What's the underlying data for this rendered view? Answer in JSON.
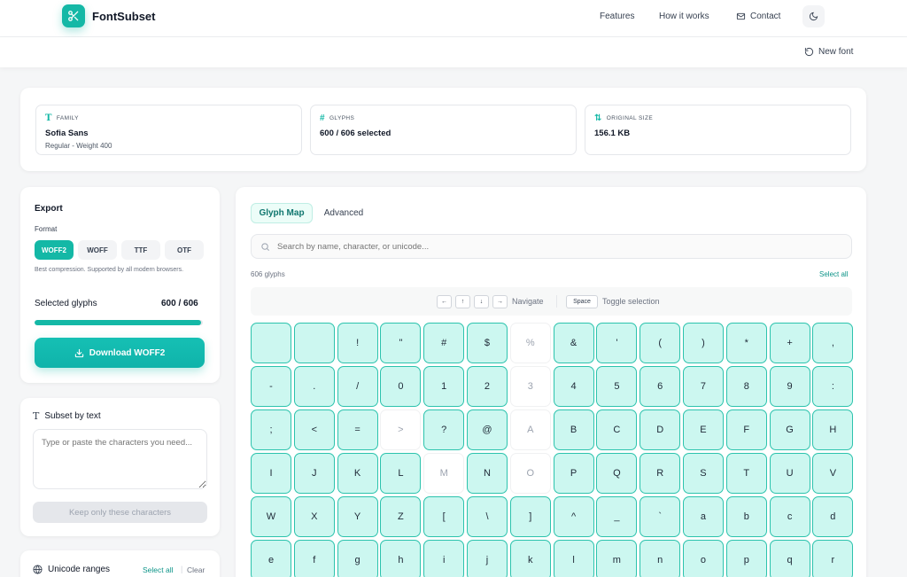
{
  "app": {
    "name": "FontSubset"
  },
  "nav": {
    "features": "Features",
    "how": "How it works",
    "contact": "Contact"
  },
  "subbar": {
    "new_font": "New font"
  },
  "stats": {
    "family_label": "FAMILY",
    "family": "Sofia Sans",
    "family_sub": "Regular - Weight 400",
    "glyphs_label": "GLYPHS",
    "glyphs": "600 / 606 selected",
    "size_label": "ORIGINAL SIZE",
    "size": "156.1 KB"
  },
  "export": {
    "title": "Export",
    "format_label": "Format",
    "formats": [
      "WOFF2",
      "WOFF",
      "TTF",
      "OTF"
    ],
    "active_format": "WOFF2",
    "hint": "Best compression. Supported by all modern browsers.",
    "selected_label": "Selected glyphs",
    "selected_value": "600 / 606",
    "progress": 0.99,
    "download": "Download WOFF2"
  },
  "subset_text": {
    "title": "Subset by text",
    "placeholder": "Type or paste the characters you need...",
    "button": "Keep only these characters"
  },
  "unicode": {
    "title": "Unicode ranges",
    "select_all": "Select all",
    "clear": "Clear"
  },
  "main": {
    "tabs": [
      "Glyph Map",
      "Advanced"
    ],
    "search_placeholder": "Search by name, character, or unicode...",
    "count": "606 glyphs",
    "select_all": "Select all",
    "keys": [
      "←",
      "↑",
      "↓",
      "→"
    ],
    "navigate": "Navigate",
    "space_key": "Space",
    "toggle": "Toggle selection"
  },
  "glyphs": [
    {
      "c": " ",
      "s": true
    },
    {
      "c": " ",
      "s": true
    },
    {
      "c": "!",
      "s": true
    },
    {
      "c": "\"",
      "s": true
    },
    {
      "c": "#",
      "s": true
    },
    {
      "c": "$",
      "s": true
    },
    {
      "c": "%",
      "s": false
    },
    {
      "c": "&",
      "s": true
    },
    {
      "c": "'",
      "s": true
    },
    {
      "c": "(",
      "s": true
    },
    {
      "c": ")",
      "s": true
    },
    {
      "c": "*",
      "s": true
    },
    {
      "c": "+",
      "s": true
    },
    {
      "c": ",",
      "s": true
    },
    {
      "c": "-",
      "s": true
    },
    {
      "c": ".",
      "s": true
    },
    {
      "c": "/",
      "s": true
    },
    {
      "c": "0",
      "s": true
    },
    {
      "c": "1",
      "s": true
    },
    {
      "c": "2",
      "s": true
    },
    {
      "c": "3",
      "s": false
    },
    {
      "c": "4",
      "s": true
    },
    {
      "c": "5",
      "s": true
    },
    {
      "c": "6",
      "s": true
    },
    {
      "c": "7",
      "s": true
    },
    {
      "c": "8",
      "s": true
    },
    {
      "c": "9",
      "s": true
    },
    {
      "c": ":",
      "s": true
    },
    {
      "c": ";",
      "s": true
    },
    {
      "c": "<",
      "s": true
    },
    {
      "c": "=",
      "s": true
    },
    {
      "c": ">",
      "s": false
    },
    {
      "c": "?",
      "s": true
    },
    {
      "c": "@",
      "s": true
    },
    {
      "c": "A",
      "s": false
    },
    {
      "c": "B",
      "s": true
    },
    {
      "c": "C",
      "s": true
    },
    {
      "c": "D",
      "s": true
    },
    {
      "c": "E",
      "s": true
    },
    {
      "c": "F",
      "s": true
    },
    {
      "c": "G",
      "s": true
    },
    {
      "c": "H",
      "s": true
    },
    {
      "c": "I",
      "s": true
    },
    {
      "c": "J",
      "s": true
    },
    {
      "c": "K",
      "s": true
    },
    {
      "c": "L",
      "s": true
    },
    {
      "c": "M",
      "s": false
    },
    {
      "c": "N",
      "s": true
    },
    {
      "c": "O",
      "s": false
    },
    {
      "c": "P",
      "s": true
    },
    {
      "c": "Q",
      "s": true
    },
    {
      "c": "R",
      "s": true
    },
    {
      "c": "S",
      "s": true
    },
    {
      "c": "T",
      "s": true
    },
    {
      "c": "U",
      "s": true
    },
    {
      "c": "V",
      "s": true
    },
    {
      "c": "W",
      "s": true
    },
    {
      "c": "X",
      "s": true
    },
    {
      "c": "Y",
      "s": true
    },
    {
      "c": "Z",
      "s": true
    },
    {
      "c": "[",
      "s": true
    },
    {
      "c": "\\",
      "s": true
    },
    {
      "c": "]",
      "s": true
    },
    {
      "c": "^",
      "s": true
    },
    {
      "c": "_",
      "s": true
    },
    {
      "c": "`",
      "s": true
    },
    {
      "c": "a",
      "s": true
    },
    {
      "c": "b",
      "s": true
    },
    {
      "c": "c",
      "s": true
    },
    {
      "c": "d",
      "s": true
    },
    {
      "c": "e",
      "s": true
    },
    {
      "c": "f",
      "s": true
    },
    {
      "c": "g",
      "s": true
    },
    {
      "c": "h",
      "s": true
    },
    {
      "c": "i",
      "s": true
    },
    {
      "c": "j",
      "s": true
    },
    {
      "c": "k",
      "s": true
    },
    {
      "c": "l",
      "s": true
    },
    {
      "c": "m",
      "s": true
    },
    {
      "c": "n",
      "s": true
    },
    {
      "c": "o",
      "s": true
    },
    {
      "c": "p",
      "s": true
    },
    {
      "c": "q",
      "s": true
    },
    {
      "c": "r",
      "s": true
    }
  ],
  "colors": {
    "accent": "#14b8a6",
    "glyph_selected_bg": "#ccf7f0",
    "glyph_selected_border": "#2cc3ad"
  }
}
